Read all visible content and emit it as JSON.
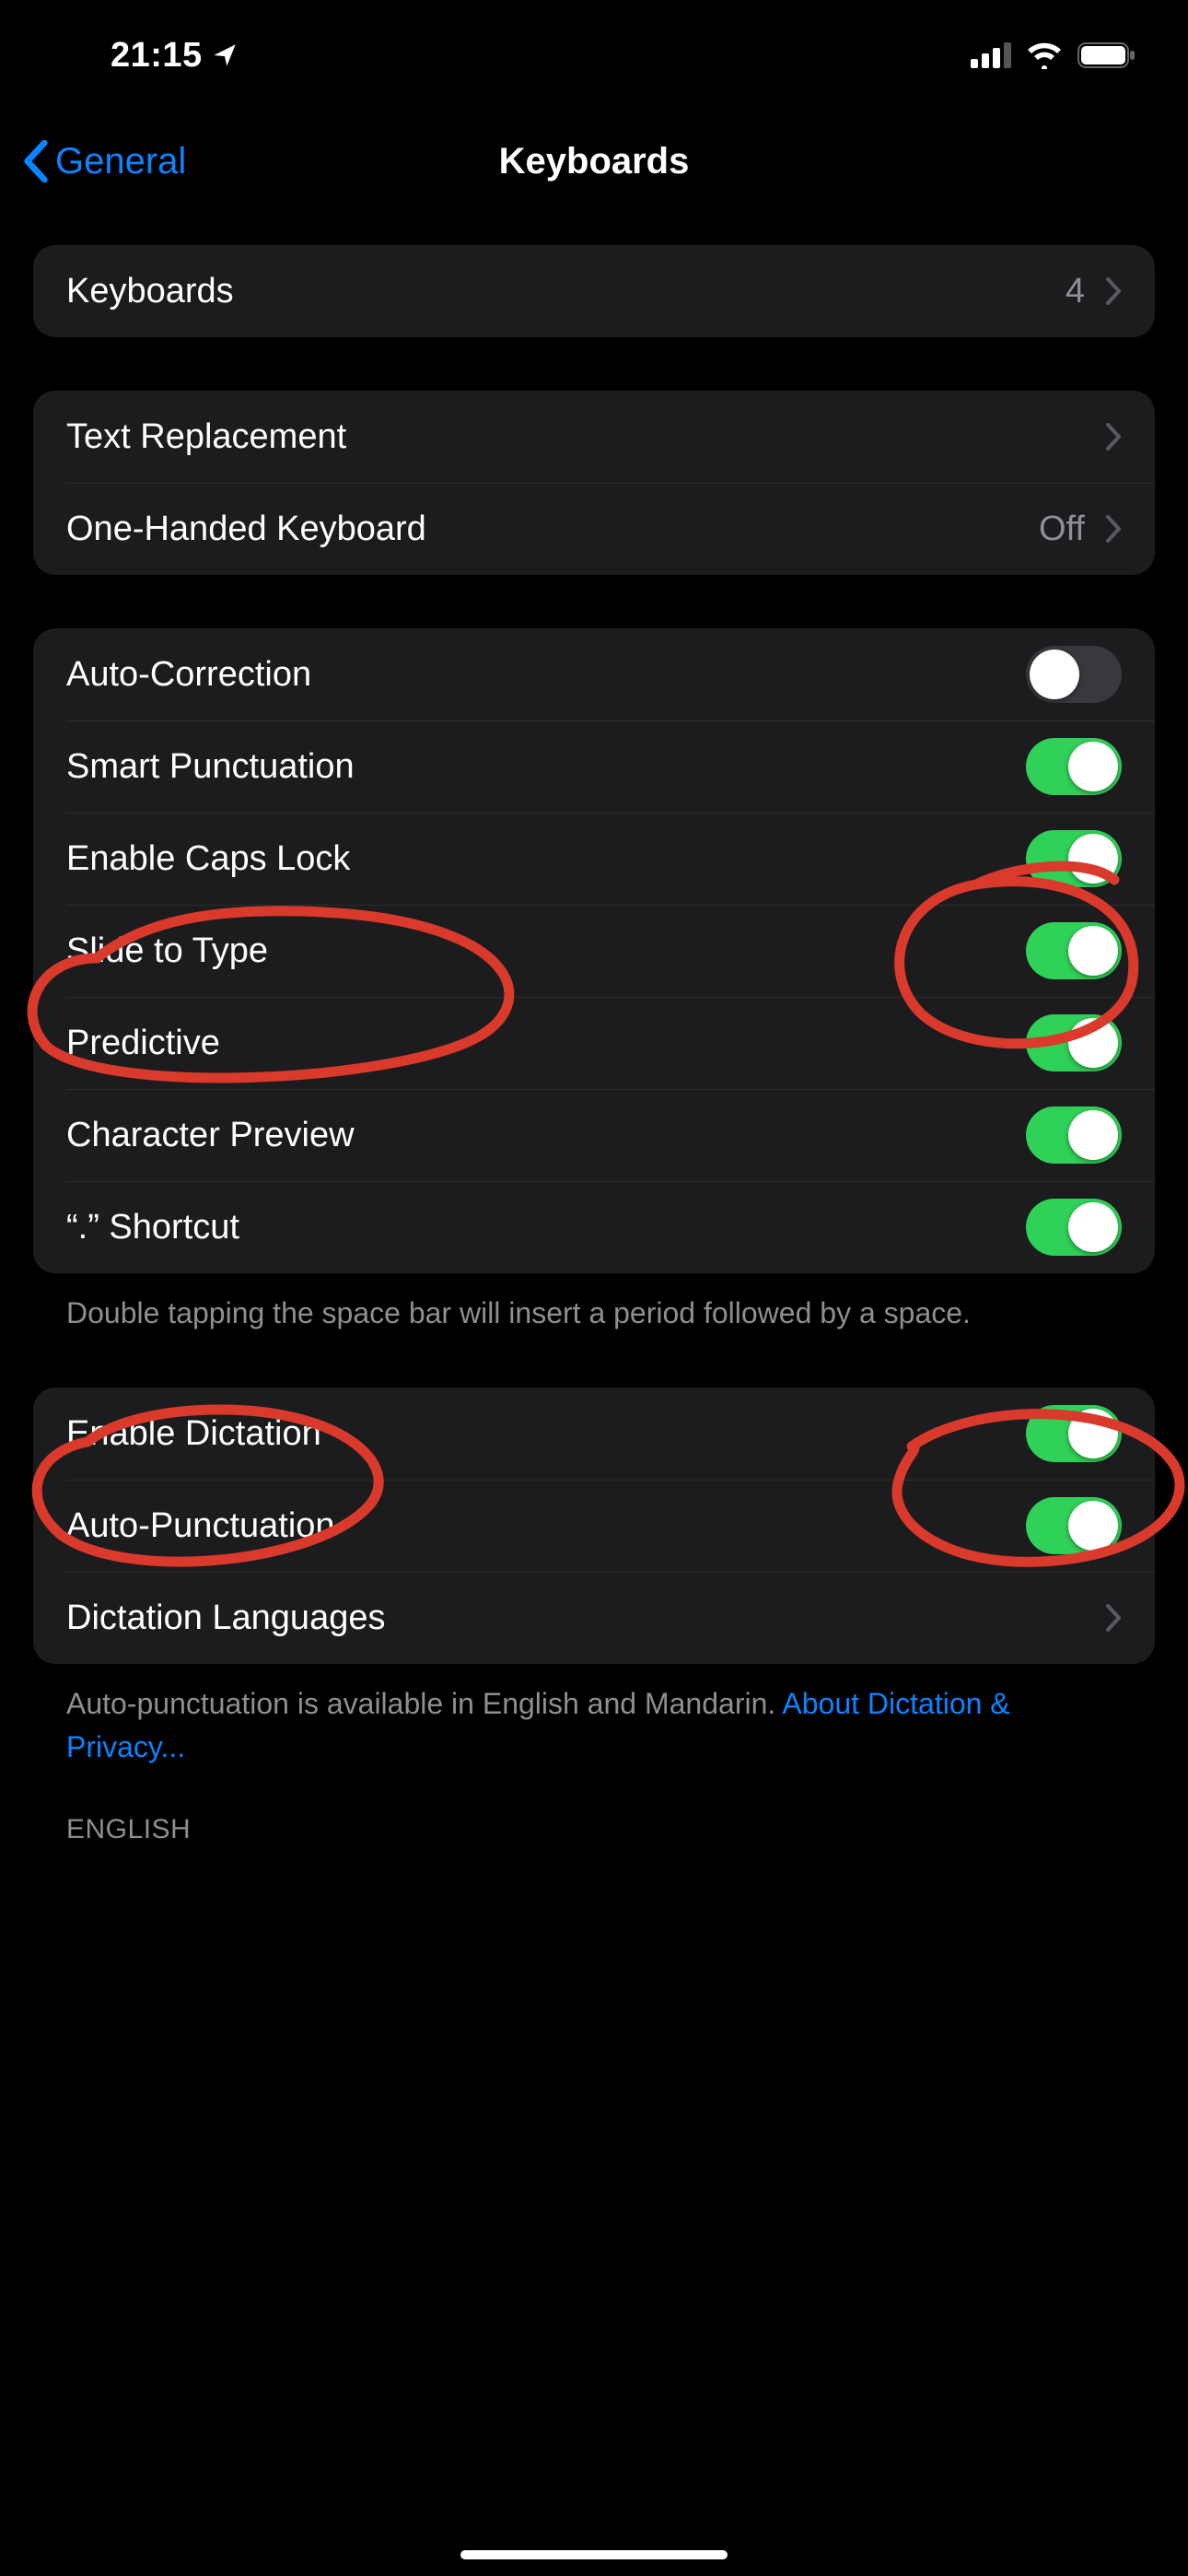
{
  "status": {
    "time": "21:15",
    "cell_bars": 3,
    "battery_pct": 100
  },
  "nav": {
    "back_label": "General",
    "title": "Keyboards"
  },
  "groups": {
    "keyboards": {
      "label": "Keyboards",
      "count": "4"
    },
    "text": {
      "text_replacement": "Text Replacement",
      "one_handed_label": "One-Handed Keyboard",
      "one_handed_value": "Off"
    },
    "typing": {
      "auto_correction": {
        "label": "Auto-Correction",
        "on": false
      },
      "smart_punct": {
        "label": "Smart Punctuation",
        "on": true
      },
      "caps_lock": {
        "label": "Enable Caps Lock",
        "on": true
      },
      "slide_type": {
        "label": "Slide to Type",
        "on": true
      },
      "predictive": {
        "label": "Predictive",
        "on": true
      },
      "char_preview": {
        "label": "Character Preview",
        "on": true
      },
      "shortcut": {
        "label": "“.” Shortcut",
        "on": true
      },
      "footer": "Double tapping the space bar will insert a period followed by a space."
    },
    "dictation": {
      "enable": {
        "label": "Enable Dictation",
        "on": true
      },
      "autopunct": {
        "label": "Auto-Punctuation",
        "on": true
      },
      "languages": {
        "label": "Dictation Languages"
      },
      "footer_plain": "Auto-punctuation is available in English and Mandarin. ",
      "footer_link": "About Dictation & Privacy..."
    },
    "english_header": "ENGLISH"
  },
  "colors": {
    "accent": "#0a84ff",
    "toggle_on": "#30d158",
    "annotation": "#d93a2b"
  }
}
